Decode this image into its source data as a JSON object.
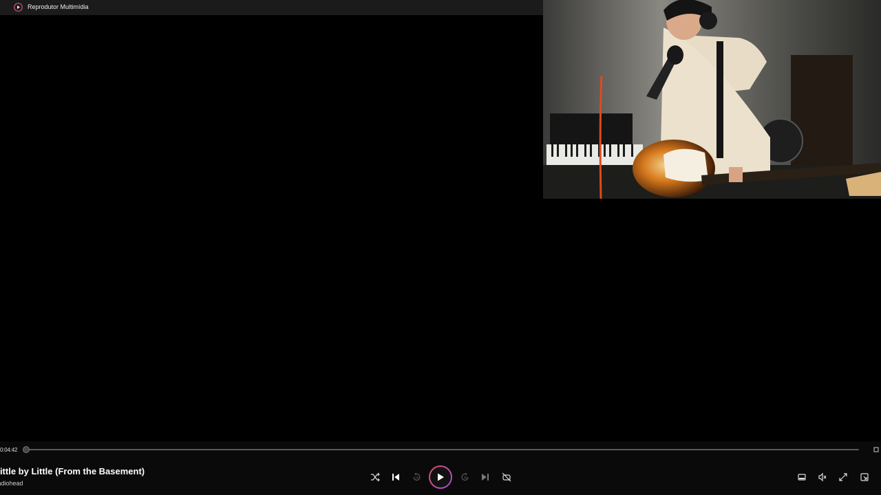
{
  "window": {
    "title": "Reprodutor Multimídia",
    "app_icon": "media-player-icon"
  },
  "video": {
    "pip_description_icon": "video-frame"
  },
  "playback": {
    "elapsed": "0:04:42",
    "progress": 0.0,
    "track_title": "Little by Little (From the Basement)",
    "artist": "Radiohead",
    "state": "paused"
  },
  "controls": {
    "shuffle": "shuffle-icon",
    "previous": "previous-track-icon",
    "rewind": "rewind-10-icon",
    "play": "play-icon",
    "forward": "forward-30-icon",
    "next": "next-track-icon",
    "repeat": "repeat-icon",
    "miniplayer": "miniplayer-icon",
    "mute": "mute-icon",
    "fullscreen": "fullscreen-icon",
    "compact": "compact-overlay-icon"
  },
  "colors": {
    "accent_start": "#e0506a",
    "accent_end": "#a64fd8",
    "bar_bg": "#0a0a0a",
    "titlebar_bg": "#1b1b1b"
  }
}
